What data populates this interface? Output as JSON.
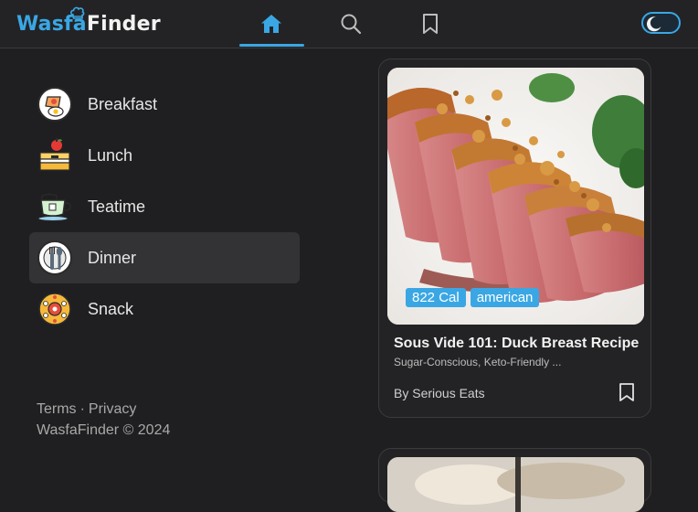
{
  "header": {
    "logo_part1": "Wasfa",
    "logo_part2": "Finder",
    "nav": [
      {
        "icon": "home-icon",
        "active": true
      },
      {
        "icon": "search-icon",
        "active": false
      },
      {
        "icon": "bookmark-icon",
        "active": false
      }
    ],
    "theme_toggle": {
      "icon": "moon-icon",
      "mode": "dark"
    }
  },
  "sidebar": {
    "items": [
      {
        "label": "Breakfast",
        "icon": "breakfast-icon",
        "active": false
      },
      {
        "label": "Lunch",
        "icon": "lunch-box-icon",
        "active": false
      },
      {
        "label": "Teatime",
        "icon": "teacup-icon",
        "active": false
      },
      {
        "label": "Dinner",
        "icon": "dinner-cutlery-icon",
        "active": true
      },
      {
        "label": "Snack",
        "icon": "snack-icon",
        "active": false
      }
    ],
    "footer": {
      "terms": "Terms",
      "dot": "·",
      "privacy": "Privacy",
      "copyright": "WasfaFinder © 2024"
    }
  },
  "recipes": [
    {
      "calories": "822 Cal",
      "cuisine": "american",
      "title": "Sous Vide 101: Duck Breast Recipe",
      "labels": "Sugar-Conscious, Keto-Friendly ...",
      "source": "By Serious Eats",
      "image": "duck-breast-photo"
    }
  ],
  "colors": {
    "accent": "#3aa7e4",
    "background": "#1f1f21",
    "surface": "#232325",
    "active_item": "#333336"
  }
}
